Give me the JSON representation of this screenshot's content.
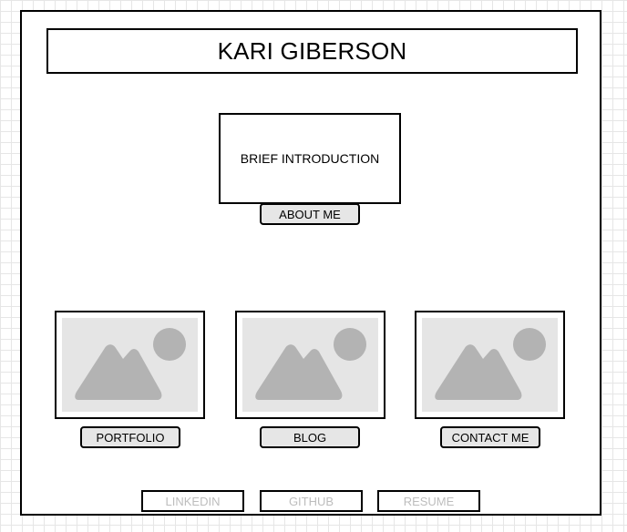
{
  "header": {
    "title": "KARI GIBERSON"
  },
  "intro": {
    "text": "BRIEF INTRODUCTION",
    "about_button_label": "ABOUT ME"
  },
  "cards": [
    {
      "label": "PORTFOLIO",
      "icon": "image-placeholder-icon"
    },
    {
      "label": "BLOG",
      "icon": "image-placeholder-icon"
    },
    {
      "label": "CONTACT ME",
      "icon": "image-placeholder-icon"
    }
  ],
  "footer": {
    "links": [
      {
        "label": "LINKEDIN"
      },
      {
        "label": "GITHUB"
      },
      {
        "label": "RESUME"
      }
    ]
  },
  "colors": {
    "button_fill": "#e6e6e6",
    "placeholder_fill": "#e5e5e5",
    "placeholder_shape": "#b3b3b3",
    "footer_text": "#bdbdbd"
  }
}
